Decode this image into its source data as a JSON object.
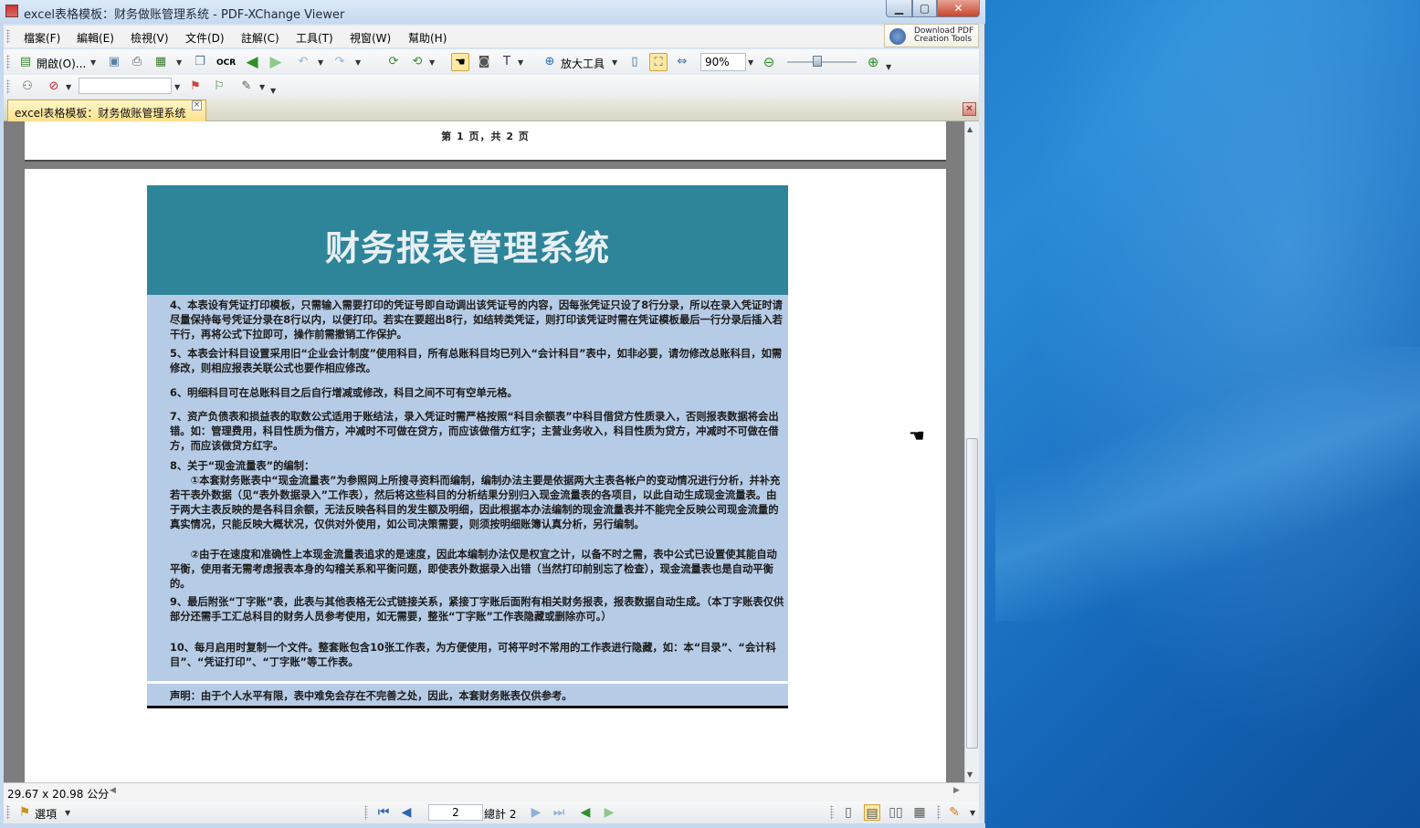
{
  "window": {
    "title": "excel表格模板：财务做账管理系统 - PDF-XChange Viewer",
    "min_glyph": "▁",
    "max_glyph": "▢",
    "close_glyph": "✕"
  },
  "menu": {
    "items": [
      "檔案(F)",
      "編輯(E)",
      "檢視(V)",
      "文件(D)",
      "註解(C)",
      "工具(T)",
      "視窗(W)",
      "幫助(H)"
    ]
  },
  "promo": {
    "line1": "Download PDF",
    "line2": "Creation Tools"
  },
  "toolbar": {
    "open_label": "開啟(O)...",
    "ocr_label": "OCR",
    "zoom_tool_label": "放大工具",
    "zoom_value": "90%"
  },
  "tabs": {
    "active_label": "excel表格模板：财务做账管理系统",
    "close_glyph": "×",
    "close_all_glyph": "✕"
  },
  "document": {
    "page1_footer": "第 1 页，共 2 页",
    "title": "财务报表管理系统",
    "paragraphs": [
      "4、本表设有凭证打印模板，只需输入需要打印的凭证号即自动调出该凭证号的内容，因每张凭证只设了8行分录，所以在录入凭证时请尽量保持每号凭证分录在8行以内，以便打印。若实在要超出8行，如结转类凭证，则打印该凭证时需在凭证模板最后一行分录后插入若干行，再将公式下拉即可，操作前需撤销工作保护。",
      "5、本表会计科目设置采用旧“企业会计制度”使用科目，所有总账科目均已列入“会计科目”表中，如非必要，请勿修改总账科目，如需修改，则相应报表关联公式也要作相应修改。",
      "6、明细科目可在总账科目之后自行增减或修改，科目之间不可有空单元格。",
      "7、资产负债表和损益表的取数公式适用于账结法，录入凭证时需严格按照“科目余额表”中科目借贷方性质录入，否则报表数据将会出错。如：管理费用，科目性质为借方，冲减时不可做在贷方，而应该做借方红字；主营业务收入，科目性质为贷方，冲减时不可做在借方，而应该做贷方红字。",
      "8、关于“现金流量表”的编制：",
      "①本套财务账表中“现金流量表”为参照网上所搜寻资料而编制，编制办法主要是依据两大主表各帐户的变动情况进行分析，并补充若干表外数据（见“表外数据录入”工作表），然后将这些科目的分析结果分别归入现金流量表的各项目，以此自动生成现金流量表。由于两大主表反映的是各科目余额，无法反映各科目的发生额及明细，因此根据本办法编制的现金流量表并不能完全反映公司现金流量的真实情况，只能反映大概状况，仅供对外使用，如公司决策需要，则须按明细账簿认真分析，另行编制。",
      "②由于在速度和准确性上本现金流量表追求的是速度，因此本编制办法仅是权宜之计，以备不时之需，表中公式已设置使其能自动平衡，使用者无需考虑报表本身的勾稽关系和平衡问题，即使表外数据录入出错（当然打印前别忘了检查），现金流量表也是自动平衡的。",
      "9、最后附张“丁字账”表，此表与其他表格无公式链接关系，紧接丁字账后面附有相关财务报表，报表数据自动生成。（本丁字账表仅供部分还需手工汇总科目的财务人员参考使用，如无需要，整张“丁字账”工作表隐藏或删除亦可。）",
      "10、每月启用时复制一个文件。整套账包含10张工作表，为方便使用，可将平时不常用的工作表进行隐藏，如：本“目录”、“会计科目”、“凭证打印”、“丁字账”等工作表。"
    ],
    "declaration": "声明：由于个人水平有限，表中难免会存在不完善之处，因此，本套财务账表仅供参考。"
  },
  "status": {
    "page_size": "29.67 x 20.98 公分",
    "options_label": "選項",
    "current_page": "2",
    "total_label": "總計 2"
  },
  "colors": {
    "header_bg": "#2e8498",
    "body_bg": "#b6cbe5",
    "tab_bg": "#fde08a"
  }
}
